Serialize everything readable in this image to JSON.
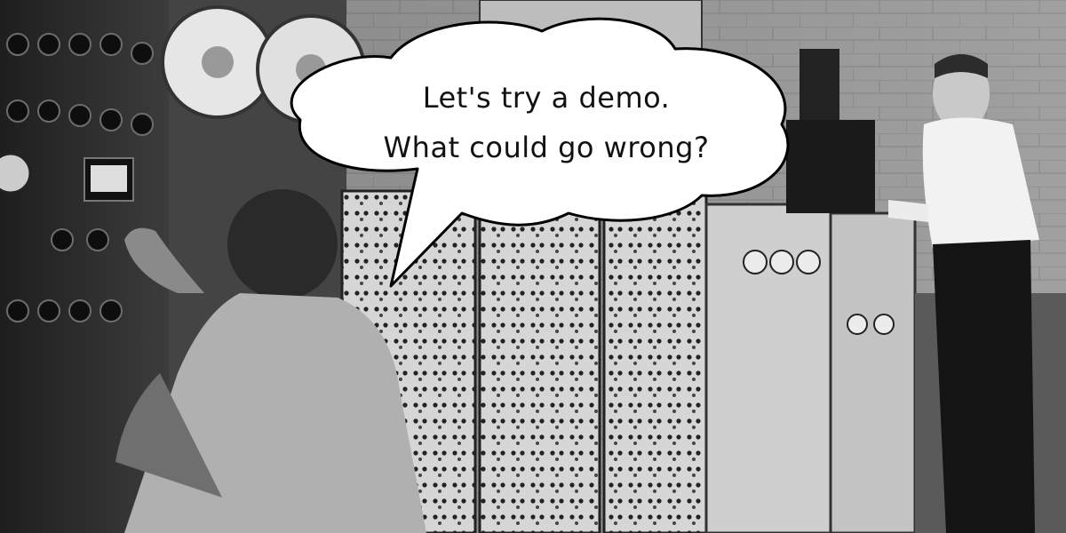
{
  "speech_bubble": {
    "line1": "Let's try a demo.",
    "line2": "What could go wrong?"
  },
  "colors": {
    "wall": "#8c8c8c",
    "panel_dark": "#2b2b2b",
    "panel_mid": "#5a5a5a",
    "bubble_fill": "#ffffff",
    "bubble_stroke": "#000000"
  },
  "icons": {
    "tape_reels": "reel-icon",
    "meters": "gauge-icon"
  }
}
